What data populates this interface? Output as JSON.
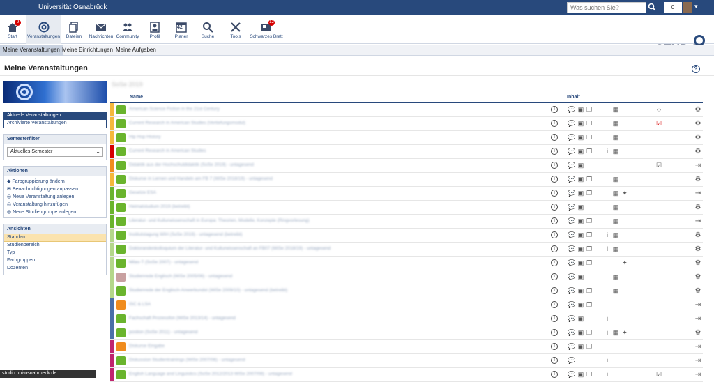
{
  "topbar": {
    "university": "Universität Osnabrück",
    "search_placeholder": "Was suchen Sie?",
    "counter": "0"
  },
  "nav": [
    {
      "label": "Start",
      "icon": "home-icon",
      "badge": "9"
    },
    {
      "label": "Veranstaltungen",
      "icon": "courses-icon",
      "active": true
    },
    {
      "label": "Dateien",
      "icon": "files-icon"
    },
    {
      "label": "Nachrichten",
      "icon": "mail-icon"
    },
    {
      "label": "Community",
      "icon": "community-icon"
    },
    {
      "label": "Profil",
      "icon": "profile-icon"
    },
    {
      "label": "Planer",
      "icon": "calendar-icon",
      "text": "42"
    },
    {
      "label": "Suche",
      "icon": "search-icon"
    },
    {
      "label": "Tools",
      "icon": "tools-icon"
    },
    {
      "label": "Schwarzes Brett",
      "icon": "board-icon",
      "badge": "12"
    }
  ],
  "logo": "STUD.IP",
  "subnav": [
    "Meine Veranstaltungen",
    "Meine Einrichtungen",
    "Meine Aufgaben"
  ],
  "page_title": "Meine Veranstaltungen",
  "sidebar": {
    "views_nav": [
      "Aktuelle Veranstaltungen",
      "Archivierte Veranstaltungen"
    ],
    "semester_filter": {
      "title": "Semesterfilter",
      "value": "Aktuelles Semester"
    },
    "actions": {
      "title": "Aktionen",
      "items": [
        "Farbgruppierung ändern",
        "Benachrichtigungen anpassen",
        "Neue Veranstaltung anlegen",
        "Veranstaltung hinzufügen",
        "Neue Studiengruppe anlegen"
      ]
    },
    "views": {
      "title": "Ansichten",
      "items": [
        "Standard",
        "Studienbereich",
        "Typ",
        "Farbgruppen",
        "Dozenten"
      ]
    }
  },
  "table": {
    "semester": "SoSe 2019",
    "col_name": "Name",
    "col_content": "Inhalt",
    "rows": [
      {
        "color": "#f5b83d",
        "name": "American Science Fiction in the 21st Century"
      },
      {
        "color": "#f5b83d",
        "name": "Current Research in American Studies (Vertiefungsmodul)"
      },
      {
        "color": "#f5b83d",
        "name": "Hip Hop History"
      },
      {
        "color": "#d60000",
        "name": "Current Research in American Studies"
      },
      {
        "color": "#f08c1e",
        "name": "Didaktik aus der Hochschuldidaktik (SoSe 2019) - untagesend"
      },
      {
        "color": "#f5b83d",
        "name": "Diskurse in Lernen und Handeln am FB 7 (WiSe 2018/19) - untagesend"
      },
      {
        "color": "#6ab42d",
        "name": "Gesetze ESA"
      },
      {
        "color": "#6ab42d",
        "name": "Heimatstudium 2019 (betreibt)"
      },
      {
        "color": "#6ab42d",
        "name": "Literatur- und Kulturwissenschaft in Europa: Theorien, Modelle, Konzepte (Ringvorlesung)"
      },
      {
        "color": "#b4d78a",
        "name": "Institutstagung WIH (SoSe 2019) - untagesend (betreibt)"
      },
      {
        "color": "#b4d78a",
        "name": "Doktorandenkolloquium der Literatur- und Kulturwissenschaft an FB07 (WiSe 2018/19) - untagesend"
      },
      {
        "color": "#b4d78a",
        "name": "Milas-T (SoSe 2007) - untagesend"
      },
      {
        "color": "#b4d78a",
        "name": "Studienrede Englisch (WiSe 2005/06) - untagesend"
      },
      {
        "color": "#b4d78a",
        "name": "Studienrede der Englisch-Anwerbundst (WiSe 2009/10) - untagesend (betreibt)"
      },
      {
        "color": "#4a6fa8",
        "name": "ISC & LSA"
      },
      {
        "color": "#4a6fa8",
        "name": "Fachschaft Prozessfon (WiSe 2013/14) - untagesend"
      },
      {
        "color": "#4a6fa8",
        "name": "postion (SoSe 2011) - untagesend"
      },
      {
        "color": "#c0256e",
        "name": "Diskurse Eingabe"
      },
      {
        "color": "#c0256e",
        "name": "Diskussion Studientrainings (WiSe 2007/08) - untagesend"
      },
      {
        "color": "#c0256e",
        "name": "English Language and Linguistics (SoSe 2012/2013 WiSe 2007/08) - untagesend"
      }
    ]
  },
  "status_url": "studip.uni-osnabrueck.de"
}
